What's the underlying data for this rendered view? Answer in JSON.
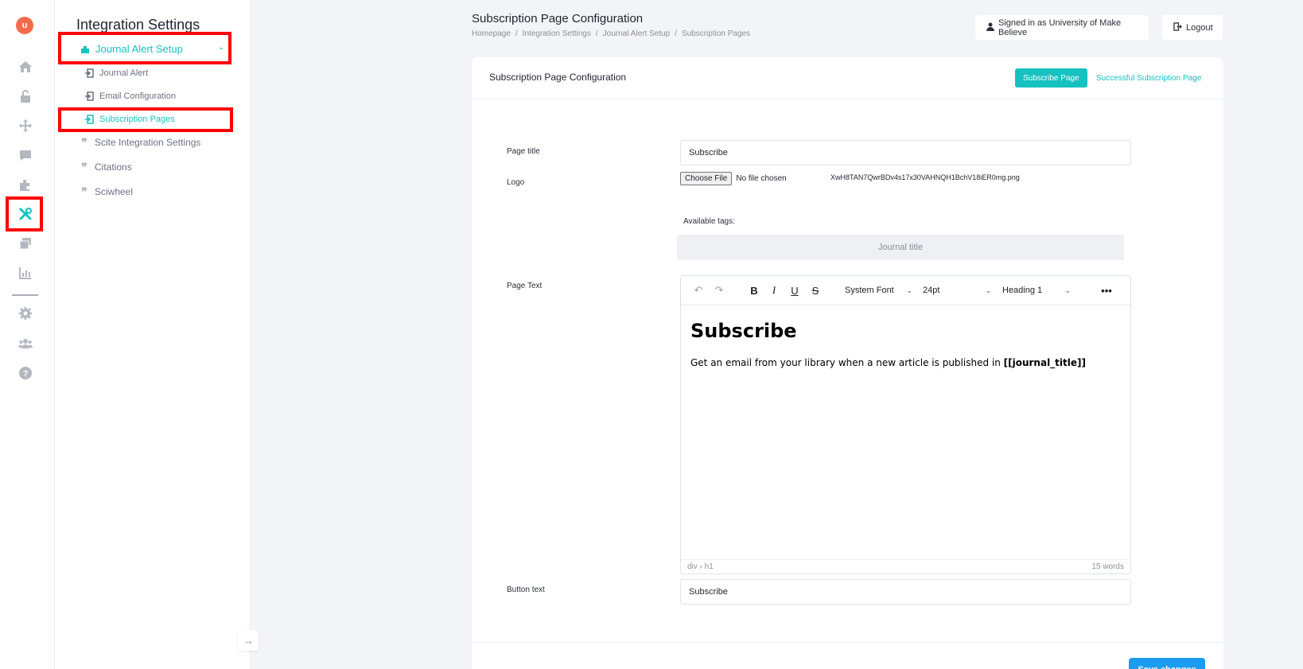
{
  "app": {
    "logo_text": "u"
  },
  "rail": {
    "items": [
      "home-icon",
      "unlock-icon",
      "move-icon",
      "comment-icon",
      "puzzle-icon",
      "tools-icon",
      "stack-icon",
      "chart-icon",
      "gear-icon",
      "users-icon",
      "help-icon"
    ],
    "active": "tools-icon"
  },
  "subnav": {
    "title": "Integration Settings",
    "journal_alert_setup": "Journal Alert Setup",
    "journal_alert": "Journal Alert",
    "email_configuration": "Email Configuration",
    "subscription_pages": "Subscription Pages",
    "scite_integration": "Scite Integration Settings",
    "citations": "Citations",
    "sciwheel": "Sciwheel",
    "collapse_glyph": "→"
  },
  "header": {
    "title": "Subscription Page Configuration",
    "breadcrumb": [
      "Homepage",
      "Integration Settings",
      "Journal Alert Setup",
      "Subscription Pages"
    ],
    "signed_in": "Signed in as University of Make Believe",
    "logout": "Logout"
  },
  "card": {
    "title": "Subscription Page Configuration",
    "tab_subscribe": "Subscribe Page",
    "tab_success": "Successful Subscription Page",
    "accent": "#16c1c1"
  },
  "form": {
    "page_title_label": "Page title",
    "page_title_value": "Subscribe",
    "logo_label": "Logo",
    "choose_file": "Choose File",
    "no_file": "No file chosen",
    "logo_filename": "XwH8TAN7QwrBDv4s17x30VAHNQH1BchV18iER0mg.png",
    "available_tags_label": "Available tags:",
    "tag_journal_title": "Journal title",
    "page_text_label": "Page Text",
    "button_text_label": "Button text",
    "button_text_value": "Subscribe",
    "save": "Save changes"
  },
  "editor": {
    "font_family": "System Font",
    "font_size": "24pt",
    "block_format": "Heading 1",
    "heading": "Subscribe",
    "body_prefix": "Get an email from your library when a new article is published in ",
    "body_tag": "[[journal_title]]",
    "path": "div › h1",
    "word_count": "15 words"
  }
}
